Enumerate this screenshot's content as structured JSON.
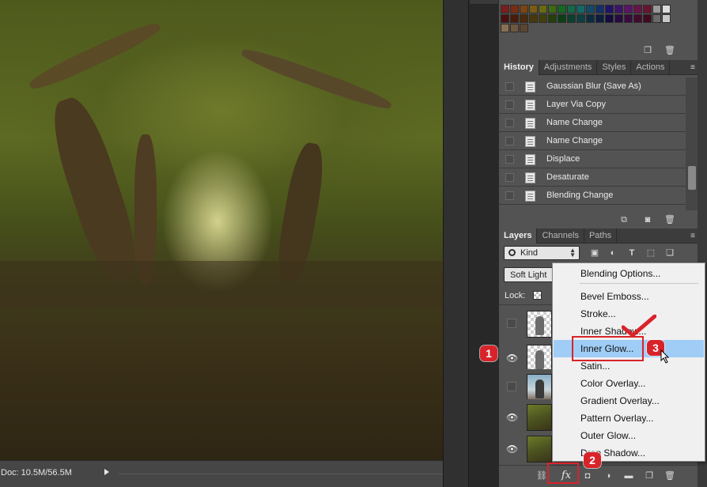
{
  "status_bar": {
    "doc_info": "Doc: 10.5M/56.5M"
  },
  "swatches": {
    "colors_row1": [
      "#7a1d1d",
      "#7a2d13",
      "#7a4513",
      "#7a5d13",
      "#6a6a13",
      "#3d6a13",
      "#136a23",
      "#136a4a",
      "#13696a",
      "#134a6a",
      "#13306a",
      "#21136a",
      "#3f136a",
      "#5d136a",
      "#6a134a",
      "#6a1330",
      "#9a9a9a",
      "#dcdcdc"
    ],
    "colors_row2": [
      "#4a1010",
      "#4a1a0b",
      "#4a2a0b",
      "#4a380b",
      "#40400b",
      "#25400b",
      "#0b4015",
      "#0b402c",
      "#0b3f40",
      "#0b2c40",
      "#0b1d40",
      "#140b40",
      "#260b40",
      "#380b40",
      "#400b2c",
      "#400b1d",
      "#6a6a6a",
      "#c8c8c8"
    ],
    "colors_row3": [
      "#8a7050",
      "#6e5840",
      "#5a4630"
    ]
  },
  "history_panel": {
    "tabs": [
      "History",
      "Adjustments",
      "Styles",
      "Actions"
    ],
    "items": [
      "Gaussian Blur (Save As)",
      "Layer Via Copy",
      "Name Change",
      "Name Change",
      "Displace",
      "Desaturate",
      "Blending Change"
    ]
  },
  "layers_panel": {
    "tabs": [
      "Layers",
      "Channels",
      "Paths"
    ],
    "filter_label": "Kind",
    "blend_mode": "Soft Light",
    "lock_label": "Lock:"
  },
  "context_menu": {
    "items": [
      "Blending Options...",
      "Bevel  Emboss...",
      "Stroke...",
      "Inner Shadow...",
      "Inner Glow...",
      "Satin...",
      "Color Overlay...",
      "Gradient Overlay...",
      "Pattern Overlay...",
      "Outer Glow...",
      "Drop Shadow..."
    ],
    "highlighted": "Inner Glow..."
  },
  "annotations": {
    "badge1": "1",
    "badge2": "2",
    "badge3": "3"
  },
  "bottom_bar": {
    "fx_label": "fx"
  },
  "accent_colors": {
    "annotation_red": "#d9232a",
    "menu_highlight": "#9fcdf5"
  }
}
